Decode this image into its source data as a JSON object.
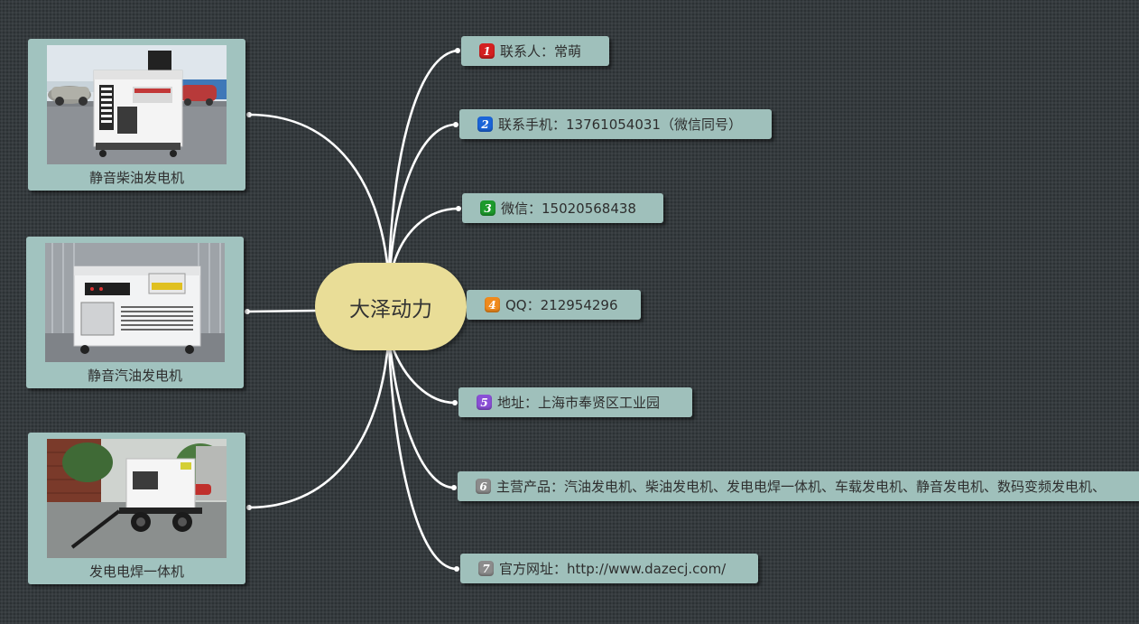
{
  "center": {
    "label": "大泽动力"
  },
  "contacts": [
    {
      "num": "1",
      "color": "#d42020",
      "text": "联系人：常萌"
    },
    {
      "num": "2",
      "color": "#1a64d8",
      "text": "联系手机：13761054031（微信同号）"
    },
    {
      "num": "3",
      "color": "#1d9a2c",
      "text": "微信：15020568438"
    },
    {
      "num": "4",
      "color": "#f08a1c",
      "text": "QQ：212954296"
    },
    {
      "num": "5",
      "color": "#8a4fd6",
      "text": "地址：上海市奉贤区工业园"
    },
    {
      "num": "6",
      "color": "#8c8c8c",
      "text": "主营产品：汽油发电机、柴油发电机、发电电焊一体机、车载发电机、静音发电机、数码变频发电机、"
    },
    {
      "num": "7",
      "color": "#8c8c8c",
      "text": "官方网址：http://www.dazecj.com/"
    }
  ],
  "products": [
    {
      "label": "静音柴油发电机",
      "image": "silent-diesel-generator-photo"
    },
    {
      "label": "静音汽油发电机",
      "image": "silent-gasoline-generator-photo"
    },
    {
      "label": "发电电焊一体机",
      "image": "generator-welder-trailer-photo"
    }
  ],
  "colors": {
    "background": "#353b3e",
    "node": "#9fc0bb",
    "center": "#e9dd97",
    "connector": "#ffffff"
  }
}
